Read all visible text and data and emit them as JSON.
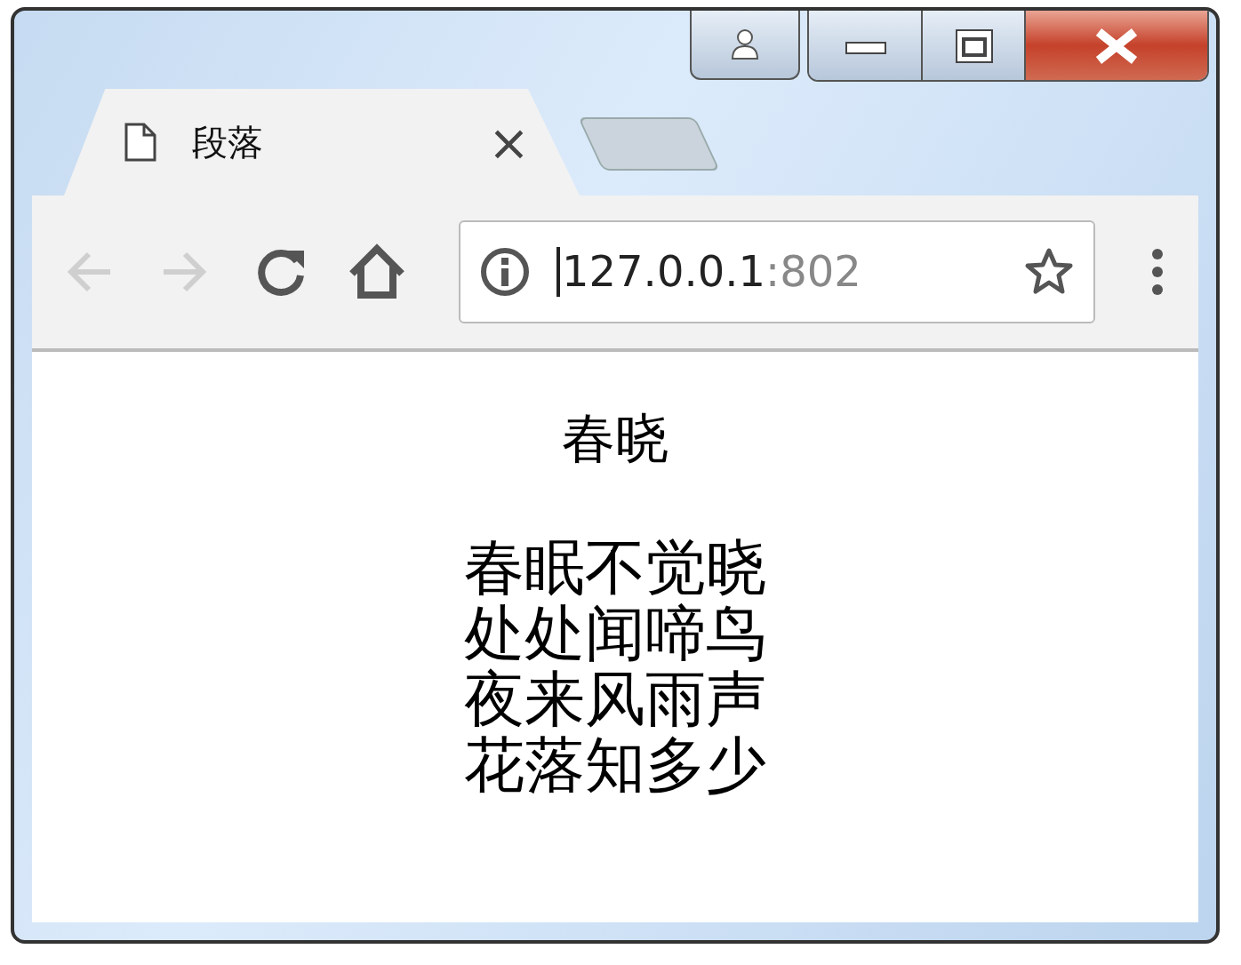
{
  "tabs": [
    {
      "title": "段落",
      "close": "×",
      "selected": true
    }
  ],
  "toolbar": {
    "back_disabled": true,
    "forward_disabled": true
  },
  "address": {
    "host": "127.0.0.1",
    "port": ":802"
  },
  "page": {
    "title": "春晓",
    "lines": [
      "春眠不觉晓",
      "处处闻啼鸟",
      "夜来风雨声",
      "花落知多少"
    ]
  }
}
